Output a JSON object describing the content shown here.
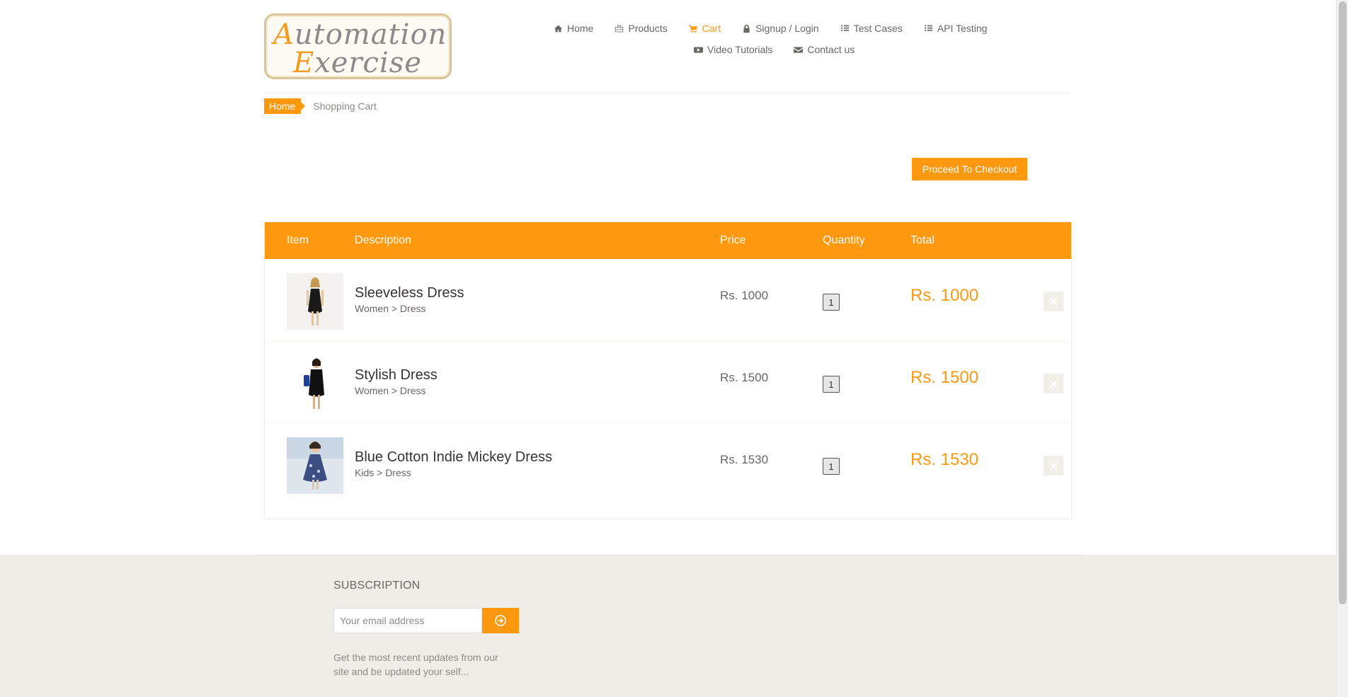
{
  "logo": {
    "line1": "Automation",
    "line2": "Exercise"
  },
  "nav": {
    "items": [
      {
        "label": "Home",
        "icon": "home-icon"
      },
      {
        "label": "Products",
        "icon": "products-icon"
      },
      {
        "label": "Cart",
        "icon": "cart-icon",
        "active": true
      },
      {
        "label": "Signup / Login",
        "icon": "lock-icon"
      },
      {
        "label": "Test Cases",
        "icon": "list-icon"
      },
      {
        "label": "API Testing",
        "icon": "list-icon"
      },
      {
        "label": "Video Tutorials",
        "icon": "youtube-icon"
      },
      {
        "label": "Contact us",
        "icon": "envelope-icon"
      }
    ]
  },
  "breadcrumb": {
    "home": "Home",
    "current": "Shopping Cart"
  },
  "checkout": {
    "label": "Proceed To Checkout"
  },
  "cart": {
    "headers": {
      "item": "Item",
      "description": "Description",
      "price": "Price",
      "quantity": "Quantity",
      "total": "Total"
    },
    "rows": [
      {
        "name": "Sleeveless Dress",
        "category": "Women > Dress",
        "price": "Rs. 1000",
        "quantity": "1",
        "total": "Rs. 1000"
      },
      {
        "name": "Stylish Dress",
        "category": "Women > Dress",
        "price": "Rs. 1500",
        "quantity": "1",
        "total": "Rs. 1500"
      },
      {
        "name": "Blue Cotton Indie Mickey Dress",
        "category": "Kids > Dress",
        "price": "Rs. 1530",
        "quantity": "1",
        "total": "Rs. 1530"
      }
    ]
  },
  "subscription": {
    "title": "SUBSCRIPTION",
    "placeholder": "Your email address",
    "text": "Get the most recent updates from our site and be updated your self..."
  },
  "colors": {
    "accent": "#fe980f",
    "text": "#696763",
    "footer_bg": "#eeede7"
  }
}
